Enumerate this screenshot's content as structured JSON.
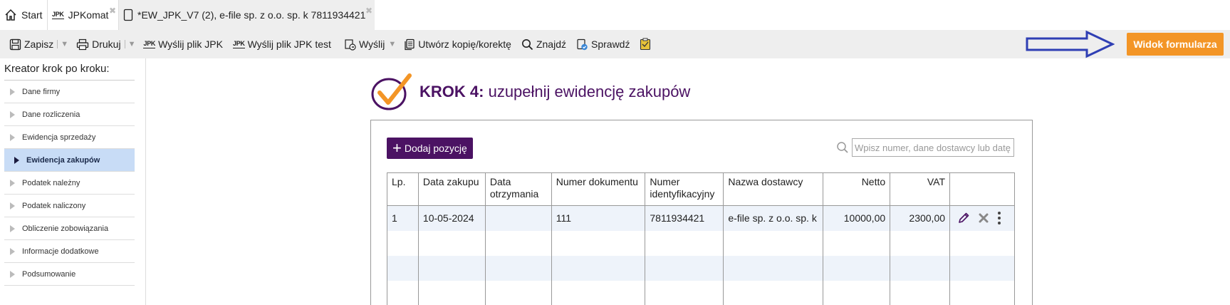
{
  "tabs": [
    {
      "label": "Start",
      "icon": "home-icon"
    },
    {
      "label": "JPKomat",
      "badge": "JPK",
      "icon": "jpk-icon"
    },
    {
      "label": "*EW_JPK_V7 (2), e-file sp. z o.o. sp. k 7811934421",
      "icon": "document-icon"
    }
  ],
  "toolbar": {
    "save": "Zapisz",
    "print": "Drukuj",
    "send_jpk": "Wyślij plik JPK",
    "send_jpk_test": "Wyślij plik JPK test",
    "send": "Wyślij",
    "create_copy": "Utwórz kopię/korektę",
    "find": "Znajdź",
    "check": "Sprawdź",
    "jpk_badge": "JPK",
    "form_view": "Widok formularza"
  },
  "colors": {
    "accent_orange": "#f39526",
    "brand_purple": "#4b1263",
    "arrow_blue": "#2f3fb4",
    "active_step_bg": "#c8dcf6"
  },
  "sidebar": {
    "title": "Kreator krok po kroku:",
    "steps": [
      {
        "label": "Dane firmy",
        "active": false
      },
      {
        "label": "Dane rozliczenia",
        "active": false
      },
      {
        "label": "Ewidencja sprzedaży",
        "active": false
      },
      {
        "label": "Ewidencja zakupów",
        "active": true
      },
      {
        "label": "Podatek należny",
        "active": false
      },
      {
        "label": "Podatek naliczony",
        "active": false
      },
      {
        "label": "Obliczenie zobowiązania",
        "active": false
      },
      {
        "label": "Informacje dodatkowe",
        "active": false
      },
      {
        "label": "Podsumowanie",
        "active": false
      }
    ]
  },
  "main": {
    "step_prefix": "KROK 4:",
    "step_title": "uzupełnij ewidencję zakupów",
    "add_button": "Dodaj pozycję",
    "search_placeholder": "Wpisz numer, dane dostawcy lub datę",
    "table": {
      "headers": [
        "Lp.",
        "Data zakupu",
        "Data otrzymania",
        "Numer dokumentu",
        "Numer identyfikacyjny",
        "Nazwa dostawcy",
        "Netto",
        "VAT",
        ""
      ],
      "rows": [
        [
          "1",
          "10-05-2024",
          "",
          "111",
          "7811934421",
          "e-file sp. z o.o. sp. k",
          "10000,00",
          "2300,00"
        ]
      ]
    }
  }
}
